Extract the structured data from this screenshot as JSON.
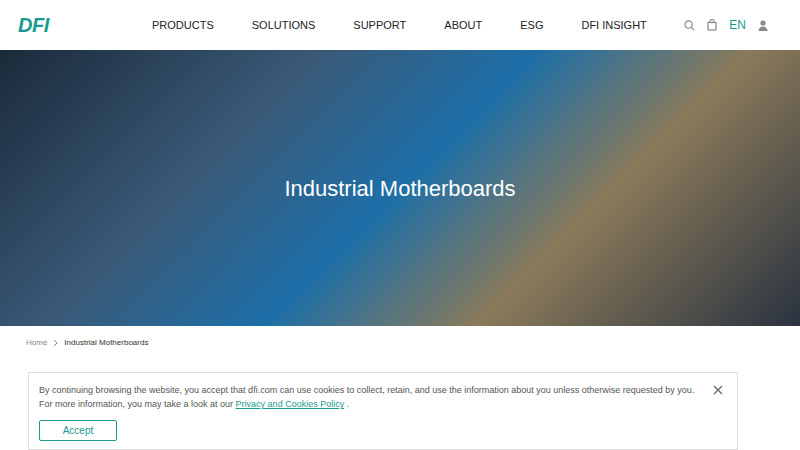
{
  "logo": "DFI",
  "nav": [
    "PRODUCTS",
    "SOLUTIONS",
    "SUPPORT",
    "ABOUT",
    "ESG",
    "DFI INSIGHT"
  ],
  "language": "EN",
  "hero": {
    "title": "Industrial Motherboards"
  },
  "breadcrumb": [
    "Home",
    "Industrial Motherboards"
  ],
  "cookie": {
    "line1": "By continuing browsing the website, you accept that dfi.com can use cookies to collect, retain, and use the information about you unless otherwise requested by you.",
    "line2": "For more information, you may take a look at our",
    "link": "Privacy and Cookies Policy",
    "end": ".",
    "accept": "Accept"
  }
}
